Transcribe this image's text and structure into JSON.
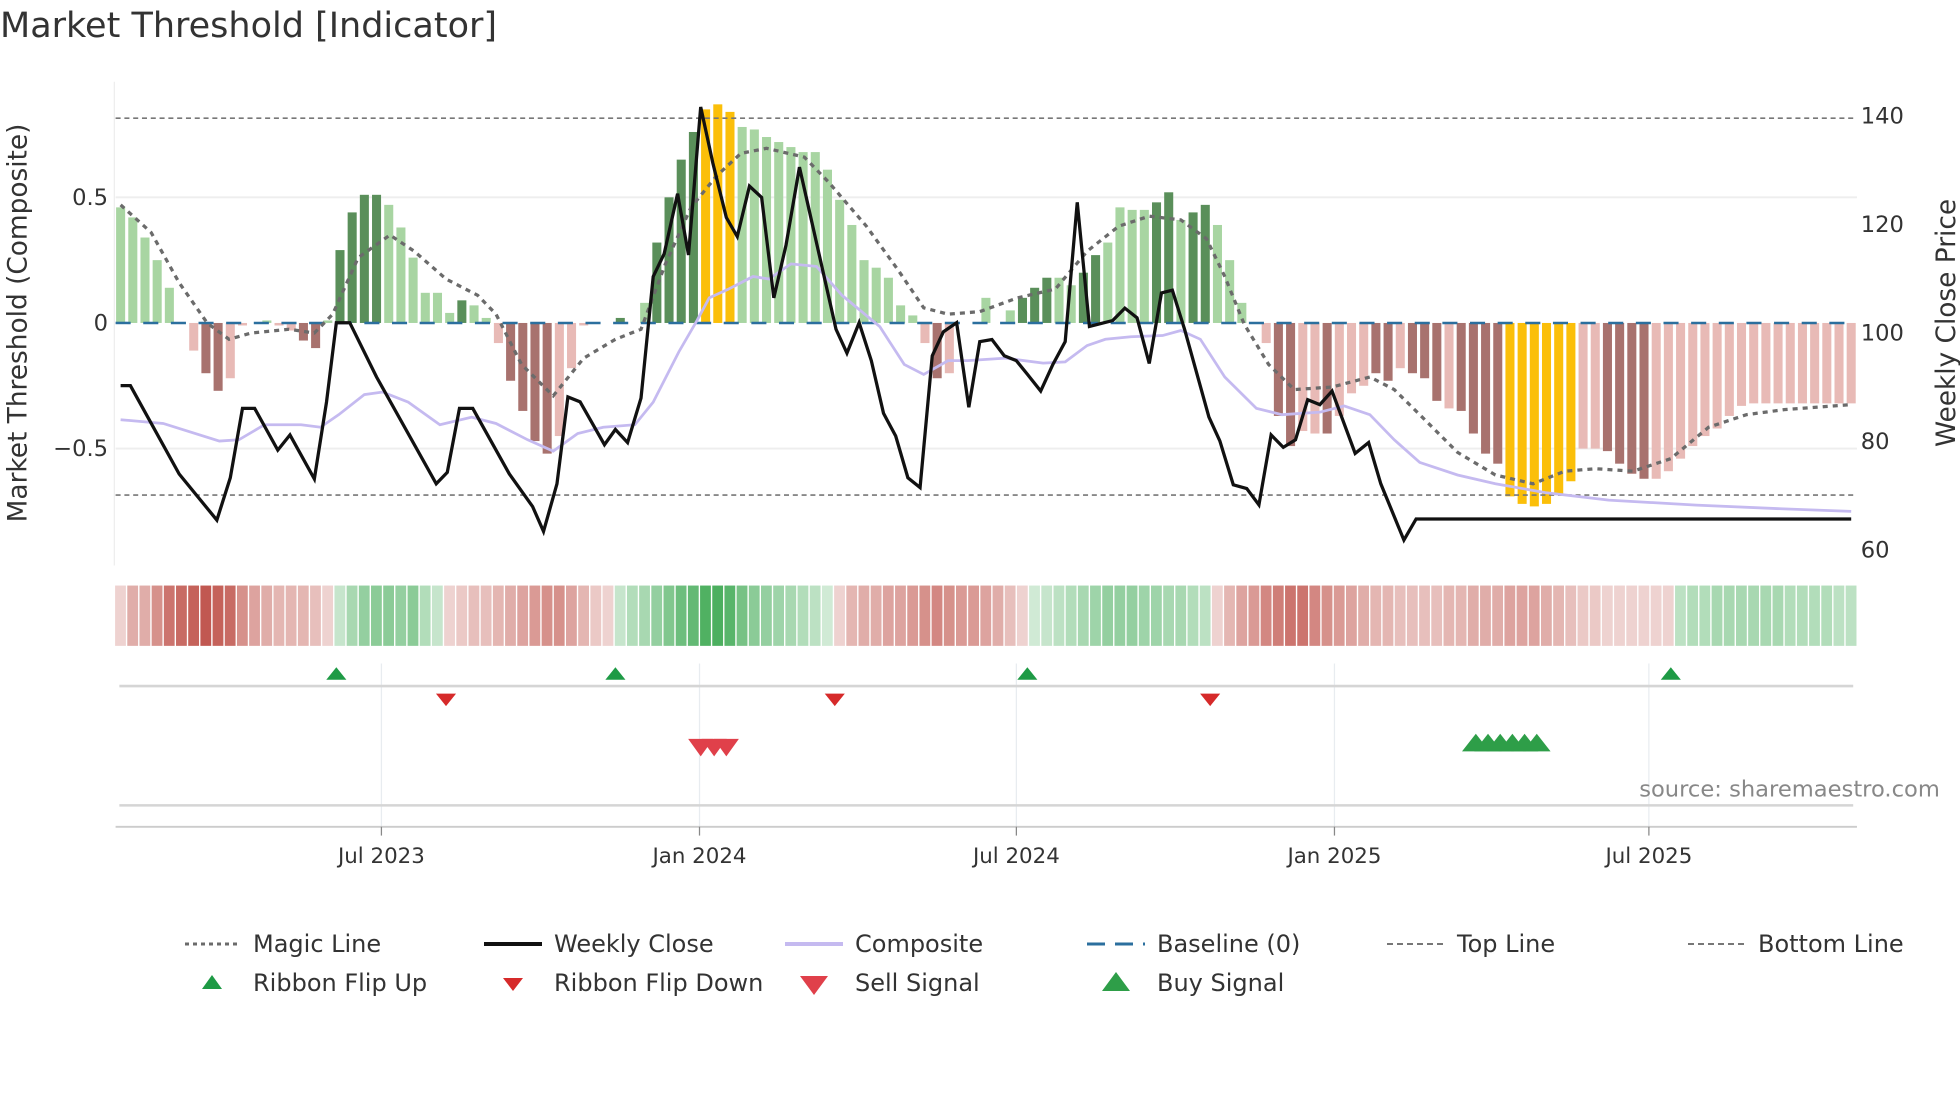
{
  "title": "Market Threshold [Indicator]",
  "source": "source: sharemaestro.com",
  "colors": {
    "bar_up": "#a8d5a2",
    "bar_up_strong": "#5a8f5a",
    "bar_down": "#e8bab6",
    "bar_down_strong": "#a8726e",
    "bar_extreme": "#fbbf09",
    "ribbon_up": "#4caf5f",
    "ribbon_down": "#c0554d",
    "weekly_close": "#111111",
    "composite": "#c5baf0",
    "magic": "#6b6b6b",
    "baseline": "#2b6f9e",
    "threshold": "#777777",
    "flip_up": "#1e9a45",
    "flip_down": "#d62a2a",
    "sell": "#e0404a",
    "buy": "#2e9e48"
  },
  "chart_data": {
    "type": "bar+line",
    "title": "Market Threshold [Indicator]",
    "ylabel": "Market Threshold (Composite)",
    "y2label": "Weekly Close Price",
    "ylim": [
      -0.95,
      0.95
    ],
    "y2lim": [
      57,
      147
    ],
    "yticks": [
      {
        "v": 0.5,
        "label": "0.5"
      },
      {
        "v": 0,
        "label": "0"
      },
      {
        "v": -0.5,
        "label": "−0.5"
      }
    ],
    "y2ticks": [
      {
        "v": 140,
        "label": "140"
      },
      {
        "v": 120,
        "label": "120"
      },
      {
        "v": 100,
        "label": "100"
      },
      {
        "v": 80,
        "label": "80"
      },
      {
        "v": 60,
        "label": "60"
      }
    ],
    "x_unit": "week index (weekly, ~Feb 2023 to Oct 2025)",
    "xticks": [
      {
        "w": 21.4,
        "label": "Jul 2023"
      },
      {
        "w": 47.5,
        "label": "Jan 2024"
      },
      {
        "w": 73.5,
        "label": "Jul 2024"
      },
      {
        "w": 99.6,
        "label": "Jan 2025"
      },
      {
        "w": 125.4,
        "label": "Jul 2025"
      }
    ],
    "top_line": 0.815,
    "bottom_line": -0.685,
    "baseline": 0,
    "bar_class_key": {
      "g": "up",
      "G": "up-strong",
      "r": "down",
      "R": "down-strong",
      "Y": "extreme"
    },
    "bar_values": [
      0.46,
      0.42,
      0.34,
      0.25,
      0.14,
      0,
      -0.11,
      -0.2,
      -0.27,
      -0.22,
      -0.01,
      0,
      0.01,
      -0.01,
      -0.03,
      -0.07,
      -0.1,
      0.01,
      0.29,
      0.44,
      0.51,
      0.51,
      0.47,
      0.38,
      0.26,
      0.12,
      0.12,
      0.04,
      0.09,
      0.07,
      0.02,
      -0.08,
      -0.23,
      -0.35,
      -0.47,
      -0.52,
      -0.45,
      -0.18,
      -0.01,
      0,
      0,
      0.02,
      0,
      0.08,
      0.32,
      0.5,
      0.65,
      0.76,
      0.85,
      0.87,
      0.84,
      0.78,
      0.77,
      0.74,
      0.72,
      0.7,
      0.68,
      0.68,
      0.61,
      0.49,
      0.39,
      0.25,
      0.22,
      0.18,
      0.07,
      0.03,
      -0.08,
      -0.22,
      -0.2,
      0,
      0,
      0.1,
      0,
      0.05,
      0.1,
      0.14,
      0.18,
      0.18,
      0.15,
      0.2,
      0.27,
      0.32,
      0.46,
      0.45,
      0.45,
      0.48,
      0.52,
      0.41,
      0.44,
      0.47,
      0.39,
      0.25,
      0.08,
      0,
      -0.08,
      -0.37,
      -0.49,
      -0.43,
      -0.44,
      -0.44,
      -0.37,
      -0.28,
      -0.25,
      -0.2,
      -0.23,
      -0.18,
      -0.2,
      -0.22,
      -0.31,
      -0.34,
      -0.35,
      -0.44,
      -0.52,
      -0.56,
      -0.69,
      -0.72,
      -0.73,
      -0.72,
      -0.68,
      -0.63,
      -0.5,
      -0.5,
      -0.51,
      -0.56,
      -0.6,
      -0.62,
      -0.62,
      -0.59,
      -0.54,
      -0.49,
      -0.45,
      -0.42,
      -0.37,
      -0.33,
      -0.32,
      -0.32,
      -0.32,
      -0.32,
      -0.32,
      -0.32,
      -0.32,
      -0.32,
      -0.32
    ],
    "bar_classes": [
      "g",
      "g",
      "g",
      "g",
      "g",
      "g",
      "r",
      "R",
      "R",
      "r",
      "r",
      "g",
      "g",
      "r",
      "r",
      "R",
      "R",
      "g",
      "G",
      "G",
      "G",
      "G",
      "g",
      "g",
      "g",
      "g",
      "g",
      "g",
      "G",
      "g",
      "g",
      "r",
      "R",
      "R",
      "R",
      "R",
      "r",
      "r",
      "r",
      "g",
      "g",
      "G",
      "g",
      "g",
      "G",
      "G",
      "G",
      "G",
      "Y",
      "Y",
      "Y",
      "g",
      "g",
      "g",
      "g",
      "g",
      "g",
      "g",
      "g",
      "g",
      "g",
      "g",
      "g",
      "g",
      "g",
      "g",
      "r",
      "R",
      "r",
      "g",
      "g",
      "g",
      "g",
      "g",
      "G",
      "G",
      "G",
      "g",
      "g",
      "G",
      "G",
      "g",
      "g",
      "g",
      "g",
      "G",
      "G",
      "g",
      "G",
      "G",
      "g",
      "g",
      "g",
      "g",
      "r",
      "R",
      "R",
      "r",
      "r",
      "R",
      "r",
      "r",
      "r",
      "R",
      "R",
      "r",
      "R",
      "R",
      "R",
      "r",
      "R",
      "R",
      "R",
      "R",
      "Y",
      "Y",
      "Y",
      "Y",
      "Y",
      "Y",
      "r",
      "r",
      "R",
      "R",
      "R",
      "R",
      "r",
      "r",
      "r",
      "r",
      "r",
      "r",
      "r",
      "r",
      "r",
      "r",
      "r",
      "r",
      "r",
      "r",
      "r",
      "r",
      "r"
    ],
    "ribbon": [
      -0.15,
      -0.35,
      -0.35,
      -0.5,
      -0.65,
      -0.7,
      -0.75,
      -0.8,
      -0.75,
      -0.7,
      -0.5,
      -0.4,
      -0.35,
      -0.3,
      -0.3,
      -0.3,
      -0.25,
      -0.15,
      0.2,
      0.35,
      0.45,
      0.5,
      0.5,
      0.45,
      0.5,
      0.3,
      0.2,
      -0.15,
      -0.2,
      -0.25,
      -0.25,
      -0.3,
      -0.35,
      -0.4,
      -0.45,
      -0.5,
      -0.5,
      -0.4,
      -0.3,
      -0.2,
      -0.15,
      0.2,
      0.3,
      0.35,
      0.45,
      0.55,
      0.65,
      0.7,
      0.8,
      0.85,
      0.75,
      0.6,
      0.5,
      0.45,
      0.4,
      0.35,
      0.3,
      0.25,
      0.15,
      -0.15,
      -0.3,
      -0.35,
      -0.35,
      -0.4,
      -0.4,
      -0.45,
      -0.5,
      -0.55,
      -0.5,
      -0.45,
      -0.45,
      -0.4,
      -0.35,
      -0.25,
      -0.15,
      0.15,
      0.2,
      0.25,
      0.3,
      0.35,
      0.4,
      0.45,
      0.45,
      0.45,
      0.4,
      0.4,
      0.35,
      0.35,
      0.3,
      0.25,
      -0.15,
      -0.3,
      -0.4,
      -0.45,
      -0.55,
      -0.6,
      -0.65,
      -0.65,
      -0.55,
      -0.5,
      -0.45,
      -0.4,
      -0.35,
      -0.3,
      -0.3,
      -0.25,
      -0.25,
      -0.25,
      -0.25,
      -0.3,
      -0.3,
      -0.35,
      -0.35,
      -0.35,
      -0.4,
      -0.4,
      -0.4,
      -0.35,
      -0.3,
      -0.25,
      -0.2,
      -0.2,
      -0.15,
      -0.15,
      -0.15,
      -0.15,
      -0.15,
      -0.15,
      0.25,
      0.3,
      0.3,
      0.35,
      0.35,
      0.35,
      0.35,
      0.35,
      0.35,
      0.3,
      0.3,
      0.3,
      0.3,
      0.25,
      0.25
    ],
    "weekly_close": [
      [
        0,
        90.3
      ],
      [
        0.8,
        90.3
      ],
      [
        4.8,
        74.0
      ],
      [
        7.9,
        65.5
      ],
      [
        9.0,
        73.3
      ],
      [
        10,
        86.1
      ],
      [
        11,
        86.1
      ],
      [
        12.9,
        78.4
      ],
      [
        13.9,
        81.2
      ],
      [
        15.9,
        73.1
      ],
      [
        16.9,
        87.3
      ],
      [
        17.7,
        101.9
      ],
      [
        18.8,
        101.9
      ],
      [
        21,
        91.9
      ],
      [
        25.9,
        72.2
      ],
      [
        26.8,
        74.3
      ],
      [
        27.8,
        86.1
      ],
      [
        28.9,
        86.1
      ],
      [
        31.9,
        74.0
      ],
      [
        33.8,
        68.0
      ],
      [
        34.7,
        63.4
      ],
      [
        35.8,
        72.2
      ],
      [
        36.7,
        88.2
      ],
      [
        37.7,
        87.3
      ],
      [
        39.7,
        79.4
      ],
      [
        40.6,
        82.2
      ],
      [
        41.6,
        79.8
      ],
      [
        42.7,
        88.0
      ],
      [
        43.7,
        110.4
      ],
      [
        44.6,
        114.6
      ],
      [
        45.7,
        125.7
      ],
      [
        46.6,
        114.4
      ],
      [
        47.6,
        141.7
      ],
      [
        48.6,
        131.3
      ],
      [
        49.7,
        121.3
      ],
      [
        50.6,
        117.8
      ],
      [
        51.6,
        127.1
      ],
      [
        52.6,
        125.0
      ],
      [
        53.6,
        106.5
      ],
      [
        54.6,
        116.2
      ],
      [
        55.7,
        130.6
      ],
      [
        58.7,
        100.7
      ],
      [
        59.6,
        96.3
      ],
      [
        60.6,
        101.9
      ],
      [
        61.6,
        94.9
      ],
      [
        62.6,
        85.2
      ],
      [
        63.6,
        81.0
      ],
      [
        64.6,
        73.3
      ],
      [
        65.6,
        71.5
      ],
      [
        66.6,
        95.8
      ],
      [
        67.5,
        100.2
      ],
      [
        68.6,
        101.9
      ],
      [
        69.6,
        86.3
      ],
      [
        70.5,
        98.4
      ],
      [
        71.5,
        98.8
      ],
      [
        72.5,
        95.8
      ],
      [
        73.5,
        94.9
      ],
      [
        74.4,
        92.4
      ],
      [
        75.5,
        89.3
      ],
      [
        76.5,
        94.2
      ],
      [
        77.5,
        98.4
      ],
      [
        78.5,
        124.1
      ],
      [
        79.5,
        101.2
      ],
      [
        81.4,
        102.3
      ],
      [
        82.4,
        104.6
      ],
      [
        83.4,
        102.8
      ],
      [
        84.4,
        94.4
      ],
      [
        85.4,
        107.4
      ],
      [
        86.3,
        107.9
      ],
      [
        87.3,
        100.7
      ],
      [
        89.3,
        84.5
      ],
      [
        90.2,
        80.1
      ],
      [
        91.3,
        72.0
      ],
      [
        92.4,
        71.3
      ],
      [
        93.4,
        68.3
      ],
      [
        94.4,
        81.2
      ],
      [
        95.4,
        78.9
      ],
      [
        96.4,
        80.3
      ],
      [
        97.4,
        87.7
      ],
      [
        98.4,
        86.8
      ],
      [
        99.4,
        89.3
      ],
      [
        101.3,
        77.8
      ],
      [
        102.4,
        79.8
      ],
      [
        103.4,
        72.2
      ],
      [
        105.3,
        61.8
      ],
      [
        106.3,
        65.7
      ],
      [
        142,
        65.7
      ]
    ],
    "magic_line": [
      [
        0,
        0.47
      ],
      [
        2.5,
        0.36
      ],
      [
        4.8,
        0.16
      ],
      [
        7.1,
        0
      ],
      [
        8.9,
        -0.065
      ],
      [
        10.7,
        -0.04
      ],
      [
        13.8,
        -0.025
      ],
      [
        15.9,
        -0.04
      ],
      [
        17.4,
        0.035
      ],
      [
        19.5,
        0.26
      ],
      [
        22.1,
        0.35
      ],
      [
        24.1,
        0.285
      ],
      [
        26.7,
        0.175
      ],
      [
        29.3,
        0.11
      ],
      [
        30.8,
        0.035
      ],
      [
        32.9,
        -0.165
      ],
      [
        35.5,
        -0.29
      ],
      [
        38.0,
        -0.14
      ],
      [
        40.6,
        -0.065
      ],
      [
        42.7,
        -0.025
      ],
      [
        44.7,
        0.235
      ],
      [
        46.8,
        0.46
      ],
      [
        48.9,
        0.585
      ],
      [
        50.9,
        0.675
      ],
      [
        53.0,
        0.695
      ],
      [
        56.1,
        0.66
      ],
      [
        58.1,
        0.56
      ],
      [
        61.2,
        0.385
      ],
      [
        63.8,
        0.21
      ],
      [
        65.9,
        0.06
      ],
      [
        67.9,
        0.035
      ],
      [
        70.5,
        0.045
      ],
      [
        73.6,
        0.1
      ],
      [
        76.7,
        0.135
      ],
      [
        79.3,
        0.285
      ],
      [
        81.9,
        0.385
      ],
      [
        84.4,
        0.425
      ],
      [
        87.0,
        0.41
      ],
      [
        89.1,
        0.335
      ],
      [
        90.6,
        0.185
      ],
      [
        92.2,
        -0.005
      ],
      [
        94.2,
        -0.165
      ],
      [
        96.3,
        -0.265
      ],
      [
        99.4,
        -0.255
      ],
      [
        102.5,
        -0.215
      ],
      [
        104.5,
        -0.265
      ],
      [
        106.6,
        -0.365
      ],
      [
        109.7,
        -0.515
      ],
      [
        112.8,
        -0.605
      ],
      [
        115.9,
        -0.64
      ],
      [
        118.5,
        -0.59
      ],
      [
        121.0,
        -0.58
      ],
      [
        124.1,
        -0.59
      ],
      [
        127.2,
        -0.54
      ],
      [
        130.3,
        -0.415
      ],
      [
        133.4,
        -0.365
      ],
      [
        136.5,
        -0.345
      ],
      [
        142,
        -0.325
      ]
    ],
    "composite": [
      [
        0,
        -0.385
      ],
      [
        3.5,
        -0.4
      ],
      [
        8.1,
        -0.47
      ],
      [
        9.7,
        -0.465
      ],
      [
        11.8,
        -0.405
      ],
      [
        14.8,
        -0.405
      ],
      [
        16.4,
        -0.415
      ],
      [
        17.9,
        -0.365
      ],
      [
        20.0,
        -0.285
      ],
      [
        21.5,
        -0.275
      ],
      [
        23.6,
        -0.315
      ],
      [
        26.2,
        -0.405
      ],
      [
        28.8,
        -0.375
      ],
      [
        30.8,
        -0.4
      ],
      [
        33.4,
        -0.465
      ],
      [
        35.5,
        -0.51
      ],
      [
        37.5,
        -0.44
      ],
      [
        39.6,
        -0.415
      ],
      [
        42.2,
        -0.405
      ],
      [
        43.7,
        -0.315
      ],
      [
        45.8,
        -0.115
      ],
      [
        47.3,
        0.01
      ],
      [
        48.3,
        0.1
      ],
      [
        49.9,
        0.135
      ],
      [
        51.9,
        0.185
      ],
      [
        53.2,
        0.175
      ],
      [
        55.0,
        0.235
      ],
      [
        57.1,
        0.225
      ],
      [
        59.2,
        0.11
      ],
      [
        62.3,
        -0.015
      ],
      [
        64.3,
        -0.165
      ],
      [
        65.9,
        -0.205
      ],
      [
        67.9,
        -0.15
      ],
      [
        69.5,
        -0.15
      ],
      [
        72.6,
        -0.14
      ],
      [
        75.7,
        -0.16
      ],
      [
        77.5,
        -0.155
      ],
      [
        79.3,
        -0.09
      ],
      [
        80.8,
        -0.065
      ],
      [
        82.9,
        -0.055
      ],
      [
        85.5,
        -0.05
      ],
      [
        87.0,
        -0.03
      ],
      [
        88.6,
        -0.065
      ],
      [
        90.6,
        -0.215
      ],
      [
        93.2,
        -0.34
      ],
      [
        95.3,
        -0.365
      ],
      [
        98.4,
        -0.355
      ],
      [
        100.4,
        -0.33
      ],
      [
        102.5,
        -0.365
      ],
      [
        104.5,
        -0.465
      ],
      [
        106.6,
        -0.555
      ],
      [
        109.7,
        -0.605
      ],
      [
        112.8,
        -0.64
      ],
      [
        116.9,
        -0.675
      ],
      [
        122.1,
        -0.705
      ],
      [
        129.3,
        -0.725
      ],
      [
        136.5,
        -0.74
      ],
      [
        142,
        -0.75
      ]
    ],
    "ribbon_flip_up_weeks": [
      17.7,
      40.6,
      74.4,
      127.2
    ],
    "ribbon_flip_down_weeks": [
      26.7,
      58.6,
      89.4
    ],
    "sell_signal_weeks": [
      47.6,
      48.7,
      49.7
    ],
    "buy_signal_weeks": [
      111.2,
      112.2,
      113.2,
      114.2,
      115.2,
      116.2
    ],
    "legend": [
      {
        "label": "Magic Line",
        "symbol": "dotted-gray"
      },
      {
        "label": "Weekly Close",
        "symbol": "solid-black"
      },
      {
        "label": "Composite",
        "symbol": "solid-lavender"
      },
      {
        "label": "Baseline (0)",
        "symbol": "dashed-blue"
      },
      {
        "label": "Top Line",
        "symbol": "dashed-gray"
      },
      {
        "label": "Bottom Line",
        "symbol": "dashed-gray"
      },
      {
        "label": "Ribbon Flip Up",
        "symbol": "triangle-up-green"
      },
      {
        "label": "Ribbon Flip Down",
        "symbol": "triangle-down-red"
      },
      {
        "label": "Sell Signal",
        "symbol": "triangle-down-red-large"
      },
      {
        "label": "Buy Signal",
        "symbol": "triangle-up-green-large"
      }
    ],
    "legend_placement": "bottom"
  }
}
